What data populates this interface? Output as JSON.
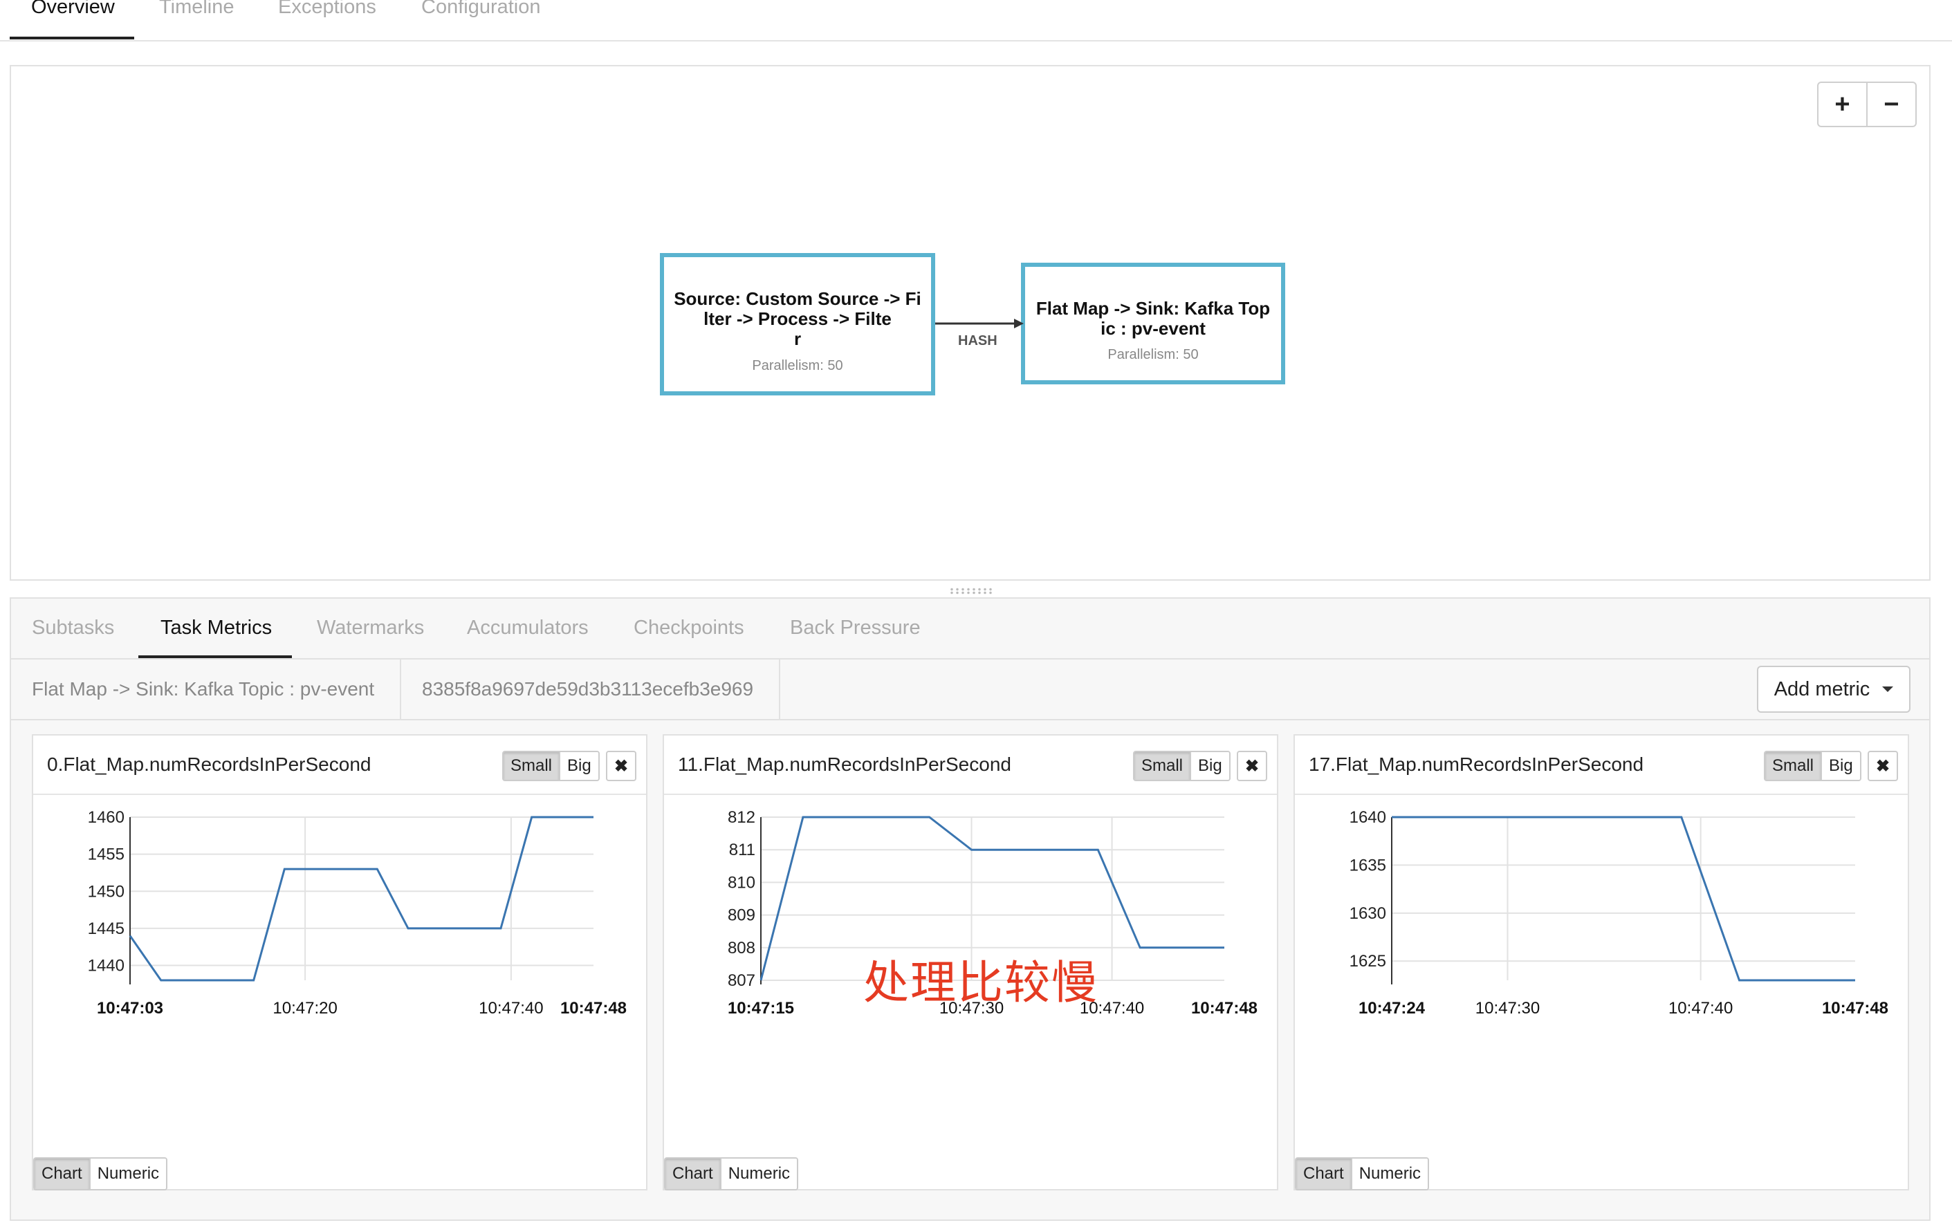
{
  "top_tabs": [
    "Overview",
    "Timeline",
    "Exceptions",
    "Configuration"
  ],
  "zoom": {
    "in_label": "+",
    "out_label": "−"
  },
  "graph": {
    "nodes": [
      {
        "title": "Source: Custom Source -> Fi\nlter -> Process -> Filte\nr",
        "parallelism": "Parallelism: 50"
      },
      {
        "title": "Flat Map -> Sink: Kafka Top\nic : pv-event",
        "parallelism": "Parallelism: 50"
      }
    ],
    "edge_label": "HASH"
  },
  "sub_tabs": [
    "Subtasks",
    "Task Metrics",
    "Watermarks",
    "Accumulators",
    "Checkpoints",
    "Back Pressure"
  ],
  "info": {
    "vertex_name": "Flat Map -> Sink: Kafka Topic : pv-event",
    "vertex_id": "8385f8a9697de59d3b3113ecefb3e969",
    "add_metric_label": "Add metric"
  },
  "metric_panels": [
    {
      "title": "0.Flat_Map.numRecordsInPerSecond",
      "small_label": "Small",
      "big_label": "Big",
      "close_label": "✖",
      "chart_label": "Chart",
      "numeric_label": "Numeric"
    },
    {
      "title": "11.Flat_Map.numRecordsInPerSecond",
      "small_label": "Small",
      "big_label": "Big",
      "close_label": "✖",
      "chart_label": "Chart",
      "numeric_label": "Numeric"
    },
    {
      "title": "17.Flat_Map.numRecordsInPerSecond",
      "small_label": "Small",
      "big_label": "Big",
      "close_label": "✖",
      "chart_label": "Chart",
      "numeric_label": "Numeric"
    }
  ],
  "annotation": "处理比较慢",
  "colors": {
    "node_border": "#5ab3cf",
    "line": "#3a75b0",
    "annotation": "#e53b22"
  },
  "chart_data": [
    {
      "type": "line",
      "yticks": [
        1440,
        1445,
        1450,
        1455,
        1460
      ],
      "ylim": [
        1438,
        1460
      ],
      "xlim": [
        "10:47:03",
        "10:47:48"
      ],
      "xticks": [
        "10:47:03",
        "10:47:20",
        "10:47:40",
        "10:47:48"
      ],
      "series": [
        {
          "x": [
            "10:47:03",
            "10:47:06",
            "10:47:15",
            "10:47:18",
            "10:47:27",
            "10:47:30",
            "10:47:39",
            "10:47:42",
            "10:47:48"
          ],
          "values": [
            1444,
            1438,
            1438,
            1453,
            1453,
            1445,
            1445,
            1460,
            1460
          ]
        }
      ]
    },
    {
      "type": "line",
      "yticks": [
        807,
        808,
        809,
        810,
        811,
        812
      ],
      "ylim": [
        807,
        812
      ],
      "xlim": [
        "10:47:15",
        "10:47:48"
      ],
      "xticks": [
        "10:47:15",
        "10:47:30",
        "10:47:40",
        "10:47:48"
      ],
      "series": [
        {
          "x": [
            "10:47:15",
            "10:47:18",
            "10:47:27",
            "10:47:30",
            "10:47:39",
            "10:47:42",
            "10:47:48"
          ],
          "values": [
            807,
            812,
            812,
            811,
            811,
            808,
            808
          ]
        }
      ]
    },
    {
      "type": "line",
      "yticks": [
        1625,
        1630,
        1635,
        1640
      ],
      "ylim": [
        1623,
        1640
      ],
      "xlim": [
        "10:47:24",
        "10:47:48"
      ],
      "xticks": [
        "10:47:24",
        "10:47:30",
        "10:47:40",
        "10:47:48"
      ],
      "series": [
        {
          "x": [
            "10:47:24",
            "10:47:39",
            "10:47:42",
            "10:47:48"
          ],
          "values": [
            1640,
            1640,
            1623,
            1623
          ]
        }
      ]
    }
  ]
}
